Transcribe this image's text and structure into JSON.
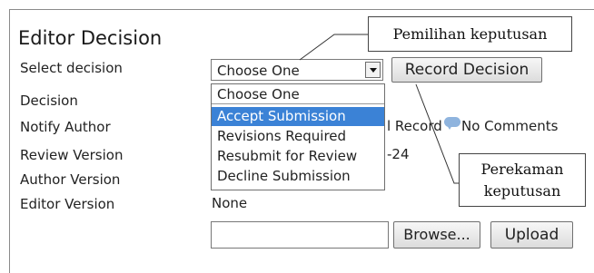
{
  "title": "Editor Decision",
  "labels": {
    "select_decision": "Select decision",
    "decision": "Decision",
    "notify_author": "Notify Author",
    "review_version": "Review Version",
    "author_version": "Author Version",
    "editor_version": "Editor Version"
  },
  "select": {
    "value": "Choose One"
  },
  "record_button": "Record Decision",
  "dropdown": {
    "options": [
      "Choose One",
      "Accept Submission",
      "Revisions Required",
      "Resubmit for Review",
      "Decline Submission"
    ],
    "highlighted": "Accept Submission"
  },
  "notify_row": {
    "partial_text": "l Record",
    "comments": "No Comments"
  },
  "review_row": {
    "partial_text": "-24"
  },
  "editor_version_value": "None",
  "upload": {
    "browse_label": "Browse...",
    "upload_label": "Upload"
  },
  "callouts": {
    "decision_selection": "Pemilihan keputusan",
    "decision_recording_line1": "Perekaman",
    "decision_recording_line2": "keputusan"
  }
}
